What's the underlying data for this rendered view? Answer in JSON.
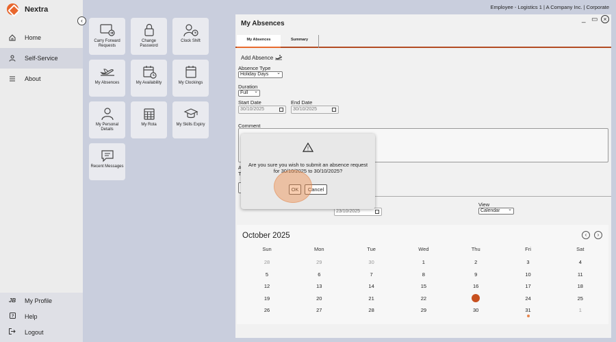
{
  "app": {
    "name": "Nextra",
    "header_context": "Employee - Logistics 1 | A Company Inc. | Corporate"
  },
  "sidebar": {
    "collapse_glyph": "‹",
    "items": [
      {
        "label": "Home",
        "icon": "home-icon",
        "active": false
      },
      {
        "label": "Self-Service",
        "icon": "person-icon",
        "active": true
      },
      {
        "label": "About",
        "icon": "menu-lines-icon",
        "active": false
      }
    ],
    "bottom": [
      {
        "label": "My Profile",
        "icon_text": "JB",
        "icon": "avatar-initials"
      },
      {
        "label": "Help",
        "icon": "help-icon"
      },
      {
        "label": "Logout",
        "icon": "logout-icon"
      }
    ]
  },
  "tiles": [
    {
      "label": "Carry Forward Requests",
      "icon": "carry-forward-icon"
    },
    {
      "label": "Change Password",
      "icon": "lock-icon"
    },
    {
      "label": "Clock Shift",
      "icon": "clock-shift-icon"
    },
    {
      "label": "My Absences",
      "icon": "airplane-icon"
    },
    {
      "label": "My Availability",
      "icon": "calendar-clock-icon"
    },
    {
      "label": "My Clockings",
      "icon": "calendar-icon"
    },
    {
      "label": "My Personal Details",
      "icon": "person-outline-icon"
    },
    {
      "label": "My Rota",
      "icon": "grid-calendar-icon"
    },
    {
      "label": "My Skills Expiry",
      "icon": "graduation-cap-icon"
    },
    {
      "label": "Recent Messages",
      "icon": "message-icon"
    }
  ],
  "panel": {
    "title": "My Absences",
    "controls": {
      "minimize": "_",
      "maximize": "▭",
      "close": "×"
    },
    "tabs": [
      "My Absences",
      "Summary"
    ],
    "add_absence": "Add Absence",
    "absence_type_label": "Absence Type",
    "absence_type_value": "Holiday Days",
    "duration_label": "Duration",
    "duration_value": "Full",
    "start_date_label": "Start Date",
    "start_date_value": "30/10/2025",
    "end_date_label": "End Date",
    "end_date_value": "30/10/2025",
    "comment_label": "Comment",
    "partial_left_a": "A",
    "partial_left_t": "T",
    "date_filter_value": "23/10/2025",
    "view_label": "View",
    "view_value": "Calendar"
  },
  "calendar": {
    "month": "October 2025",
    "weekdays": [
      "Sun",
      "Mon",
      "Tue",
      "Wed",
      "Thu",
      "Fri",
      "Sat"
    ],
    "weeks": [
      [
        "28",
        "29",
        "30",
        "1",
        "2",
        "3",
        "4"
      ],
      [
        "5",
        "6",
        "7",
        "8",
        "9",
        "10",
        "11"
      ],
      [
        "12",
        "13",
        "14",
        "15",
        "16",
        "17",
        "18"
      ],
      [
        "19",
        "20",
        "21",
        "22",
        "23",
        "24",
        "25"
      ],
      [
        "26",
        "27",
        "28",
        "29",
        "30",
        "31",
        "1"
      ]
    ],
    "muted_first_week": [
      0,
      1,
      2
    ],
    "muted_last_week": [
      6
    ],
    "today": "23",
    "accent": "#c7501f"
  },
  "dialog": {
    "message": "Are you sure you wish to submit an absence request for 30/10/2025 to 30/10/2025?",
    "ok_label": "OK",
    "cancel_label": "Cancel",
    "warning_glyph": "!"
  },
  "colors": {
    "brand": "#e8662d",
    "sidebar_bg": "#ececec",
    "canvas_bg": "#c9cedd"
  }
}
